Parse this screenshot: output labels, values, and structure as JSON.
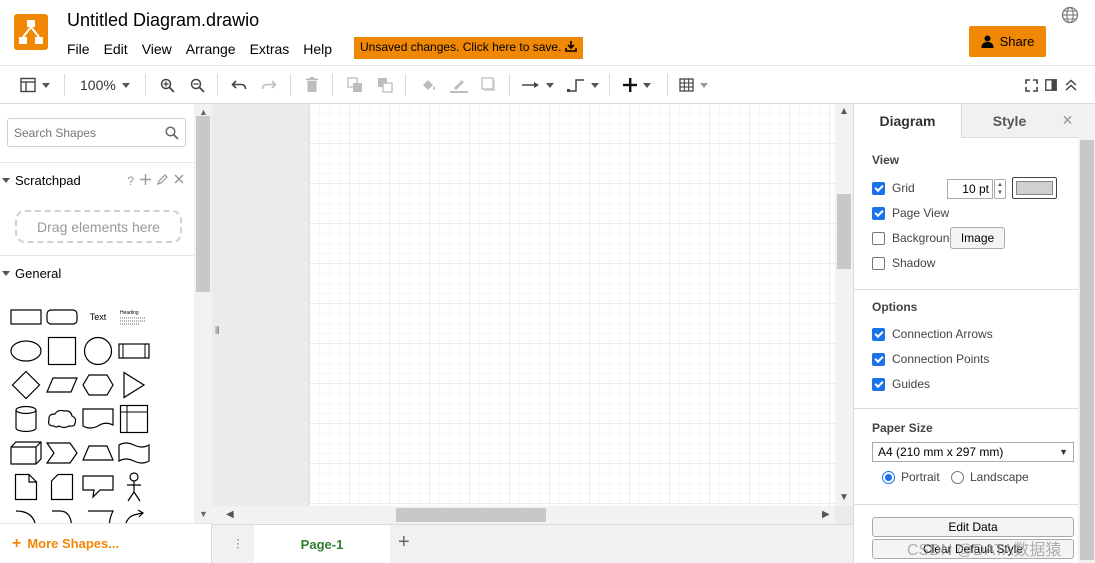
{
  "app": {
    "title": "Untitled Diagram.drawio",
    "unsaved_notice": "Unsaved changes. Click here to save.",
    "share_label": "Share",
    "accent_color": "#f08705"
  },
  "menu": [
    "File",
    "Edit",
    "View",
    "Arrange",
    "Extras",
    "Help"
  ],
  "toolbar": {
    "zoom": "100%",
    "icons": [
      "format-panel-toggle-icon",
      "zoom-in-icon",
      "zoom-out-icon",
      "undo-icon",
      "redo-icon",
      "delete-icon",
      "to-front-icon",
      "to-back-icon",
      "fill-color-icon",
      "line-color-icon",
      "shadow-icon",
      "connection-icon",
      "waypoints-icon",
      "insert-icon",
      "table-icon",
      "fullscreen-icon",
      "format-icon",
      "collapse-icon"
    ]
  },
  "sidebar": {
    "search_placeholder": "Search Shapes",
    "scratchpad_label": "Scratchpad",
    "scratchpad_help": "?",
    "drop_hint": "Drag elements here",
    "general_label": "General",
    "text_shape_label": "Text",
    "heading_shape_label": "Heading",
    "more_shapes_label": "More Shapes..."
  },
  "pages": {
    "tabs": [
      "Page-1"
    ],
    "active": "Page-1"
  },
  "panel": {
    "tabs": [
      "Diagram",
      "Style"
    ],
    "close_label": "✕",
    "view_title": "View",
    "grid_label": "Grid",
    "grid_checked": true,
    "grid_size": "10 pt",
    "page_view_label": "Page View",
    "page_view_checked": true,
    "background_label": "Background",
    "background_checked": false,
    "image_button": "Image",
    "shadow_label": "Shadow",
    "shadow_checked": false,
    "options_title": "Options",
    "connection_arrows_label": "Connection Arrows",
    "connection_points_label": "Connection Points",
    "guides_label": "Guides",
    "paper_size_title": "Paper Size",
    "paper_size_value": "A4 (210 mm x 297 mm)",
    "portrait_label": "Portrait",
    "landscape_label": "Landscape",
    "orientation": "Portrait",
    "edit_data_label": "Edit Data",
    "clear_style_label": "Clear Default Style"
  },
  "watermark": "CSDN @DATA数据猿"
}
